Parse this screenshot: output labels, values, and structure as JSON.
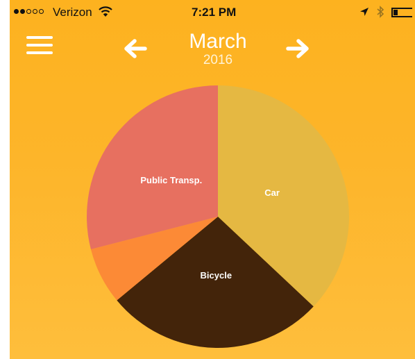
{
  "status_bar": {
    "carrier": "Verizon",
    "time": "7:21 PM",
    "signal_bars_filled": 2,
    "signal_bars_total": 5
  },
  "header": {
    "month": "March",
    "year": "2016",
    "menu_icon": "hamburger-menu-icon",
    "prev_icon": "arrow-left-icon",
    "next_icon": "arrow-right-icon"
  },
  "chart_data": {
    "type": "pie",
    "title": "",
    "slices": [
      {
        "label": "Car",
        "value": 37,
        "color": "#E5B842"
      },
      {
        "label": "Bicycle",
        "value": 27,
        "color": "#43240A"
      },
      {
        "label": "",
        "value": 7,
        "color": "#FC8A36"
      },
      {
        "label": "Public Transp.",
        "value": 29,
        "color": "#E77060"
      }
    ]
  }
}
